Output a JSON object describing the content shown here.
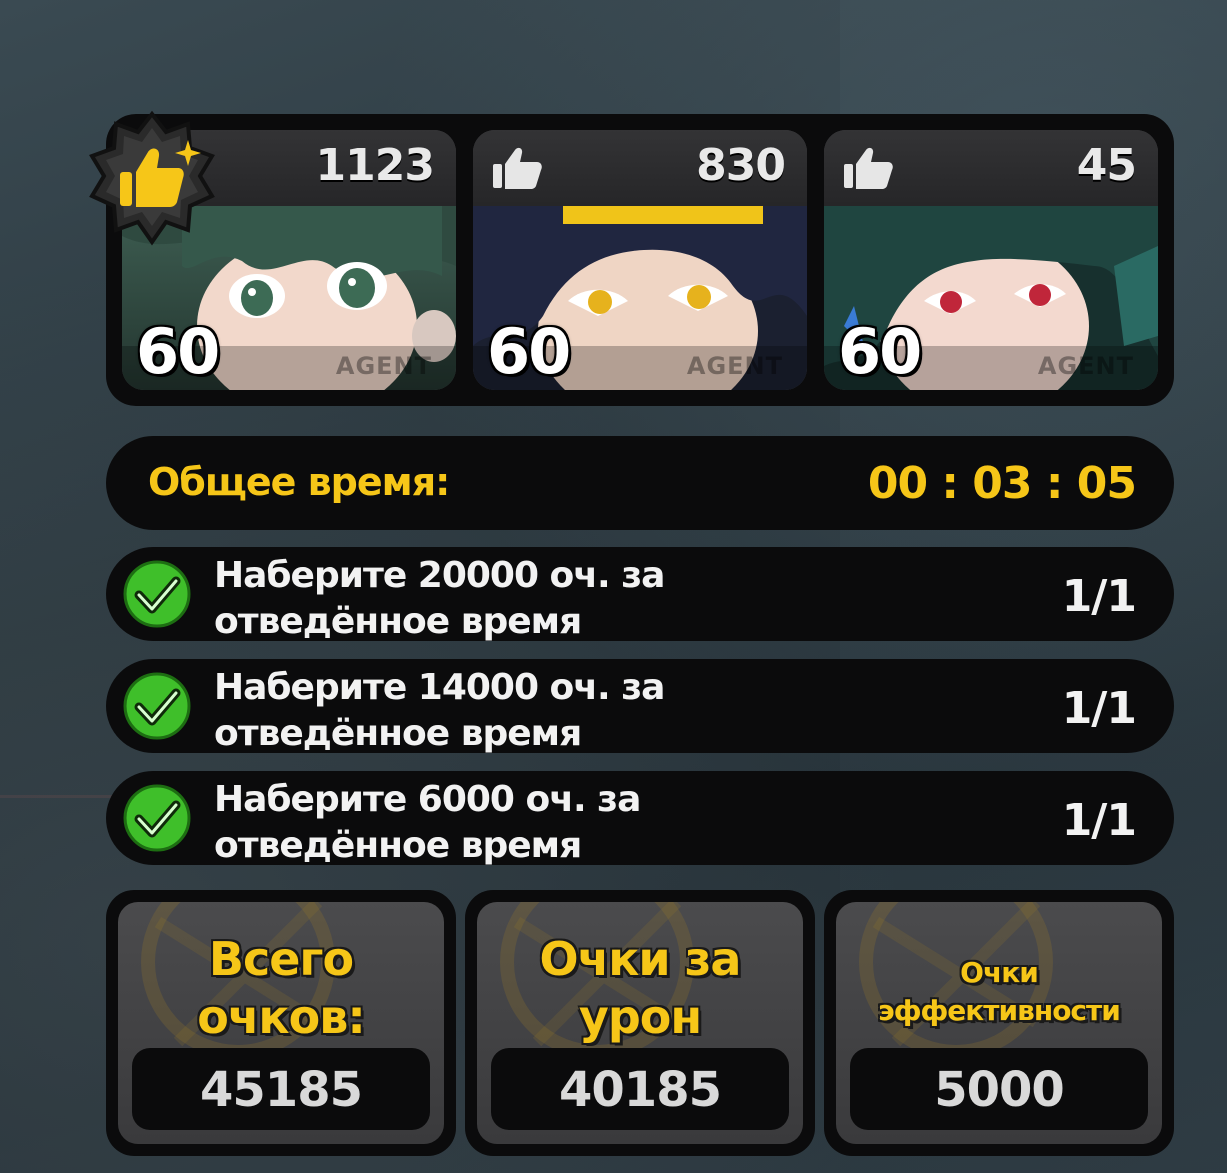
{
  "agents": [
    {
      "likes": "1123",
      "level": "60",
      "tag": "AGENT",
      "top_liked": true
    },
    {
      "likes": "830",
      "level": "60",
      "tag": "AGENT",
      "top_liked": false
    },
    {
      "likes": "45",
      "level": "60",
      "tag": "AGENT",
      "top_liked": false
    }
  ],
  "total_time": {
    "label": "Общее время:",
    "value": "00 : 03 : 05"
  },
  "objectives": [
    {
      "text": "Наберите 20000 оч. за\nотведённое время",
      "progress": "1/1",
      "completed": true
    },
    {
      "text": "Наберите 14000 оч. за\nотведённое время",
      "progress": "1/1",
      "completed": true
    },
    {
      "text": "Наберите 6000 оч. за\nотведённое время",
      "progress": "1/1",
      "completed": true
    }
  ],
  "scores": [
    {
      "title": "Всего\nочков:",
      "value": "45185"
    },
    {
      "title": "Очки за\nурон",
      "value": "40185"
    },
    {
      "title": "Очки\nэффективности",
      "value": "5000"
    }
  ],
  "colors": {
    "accent_yellow": "#f6c618",
    "panel_black": "#0b0b0c",
    "check_green": "#3fbf2a"
  },
  "icons": [
    "thumbs-up-icon",
    "star-badge-icon",
    "checkmark-icon"
  ]
}
